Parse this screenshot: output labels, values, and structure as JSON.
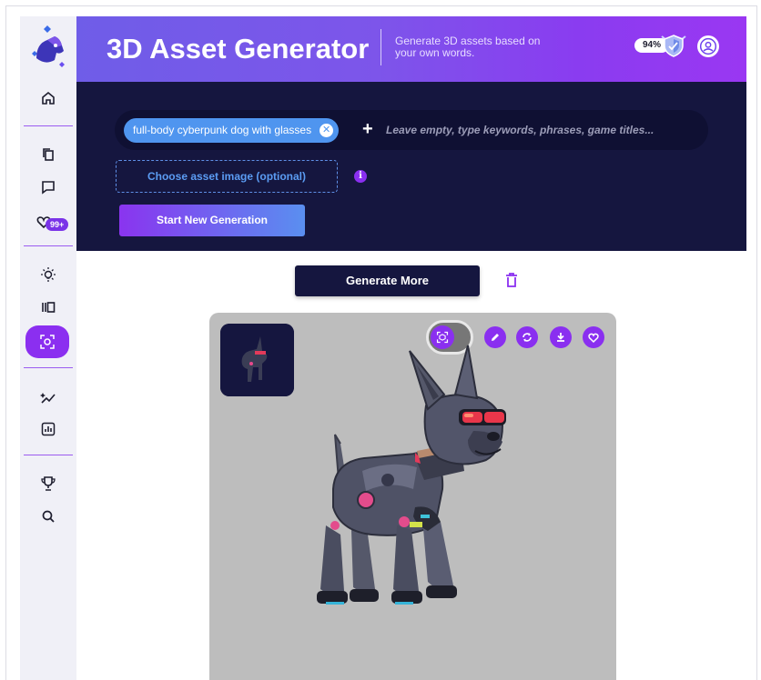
{
  "header": {
    "title": "3D Asset Generator",
    "subtitle": "Generate 3D assets based on your own words.",
    "progress_percent": "94%"
  },
  "sidebar": {
    "favorites_badge": "99+",
    "items": [
      {
        "icon": "home-icon"
      },
      {
        "icon": "copy-icon"
      },
      {
        "icon": "chat-icon"
      },
      {
        "icon": "heart-icon"
      },
      {
        "icon": "lightbulb-icon"
      },
      {
        "icon": "gallery-icon"
      },
      {
        "icon": "3d-generator-icon",
        "active": true
      },
      {
        "icon": "sparkle-trend-icon"
      },
      {
        "icon": "analytics-icon"
      },
      {
        "icon": "trophy-icon"
      },
      {
        "icon": "search-icon"
      }
    ]
  },
  "prompt": {
    "chip_text": "full-body cyberpunk dog with glasses",
    "placeholder": "Leave empty, type keywords, phrases, game titles..."
  },
  "actions": {
    "choose_image": "Choose asset image (optional)",
    "start_generation": "Start New Generation",
    "generate_more": "Generate More"
  },
  "colors": {
    "accent": "#8a2ff0",
    "panel": "#15163f",
    "chip": "#4f95ef",
    "canvas": "#bdbdbd"
  }
}
